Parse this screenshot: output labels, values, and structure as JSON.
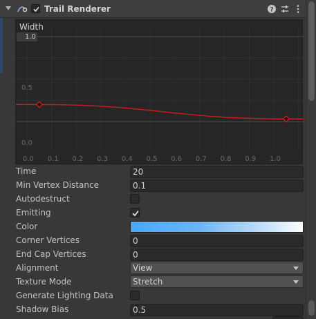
{
  "component": {
    "title": "Trail Renderer",
    "enabled": true,
    "icons": [
      "trail-renderer-icon",
      "help-icon",
      "preset-icon",
      "context-menu-icon"
    ]
  },
  "curve": {
    "label": "Width",
    "top_value": "1.0",
    "y_ticks": [
      "0.5",
      "0.0"
    ],
    "x_ticks": [
      "0.0",
      "0.1",
      "0.2",
      "0.3",
      "0.4",
      "0.5",
      "0.6",
      "0.7",
      "0.8",
      "0.9",
      "1.0"
    ],
    "keys": [
      {
        "t": 0.05,
        "v": 0.2
      },
      {
        "t": 1.05,
        "v": 0.03
      }
    ],
    "curve_color": "#c41e1e"
  },
  "properties": {
    "time": {
      "label": "Time",
      "value": "20"
    },
    "min_vertex_distance": {
      "label": "Min Vertex Distance",
      "value": "0.1"
    },
    "autodestruct": {
      "label": "Autodestruct",
      "checked": false
    },
    "emitting": {
      "label": "Emitting",
      "checked": true
    },
    "color": {
      "label": "Color",
      "gradient_start": "#4aa7fb",
      "gradient_end": "#ffffff"
    },
    "corner_vertices": {
      "label": "Corner Vertices",
      "value": "0"
    },
    "end_cap_vertices": {
      "label": "End Cap Vertices",
      "value": "0"
    },
    "alignment": {
      "label": "Alignment",
      "value": "View"
    },
    "texture_mode": {
      "label": "Texture Mode",
      "value": "Stretch"
    },
    "generate_lighting_data": {
      "label": "Generate Lighting Data",
      "checked": false
    },
    "shadow_bias": {
      "label": "Shadow Bias",
      "value": "0.5"
    }
  }
}
